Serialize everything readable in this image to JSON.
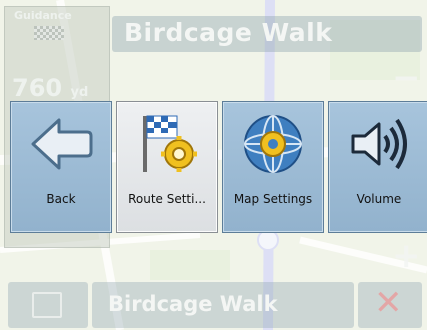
{
  "guidance": {
    "label": "Guidance",
    "distance_value": "760",
    "distance_unit": "yd"
  },
  "street": {
    "current": "Birdcage Walk",
    "next": "Birdcage Walk"
  },
  "menu": {
    "buttons": [
      {
        "label": "Back",
        "icon": "back-arrow-icon",
        "selected": false
      },
      {
        "label": "Route Setti...",
        "icon": "route-settings-icon",
        "selected": true
      },
      {
        "label": "Map Settings",
        "icon": "map-settings-icon",
        "selected": false
      },
      {
        "label": "Volume",
        "icon": "volume-icon",
        "selected": false
      }
    ]
  },
  "zoom": {
    "plus": "+",
    "minus": "−"
  },
  "colors": {
    "button": "#9fbdd6",
    "button_selected": "#e6e8ea",
    "map": "#d9e2c9"
  }
}
